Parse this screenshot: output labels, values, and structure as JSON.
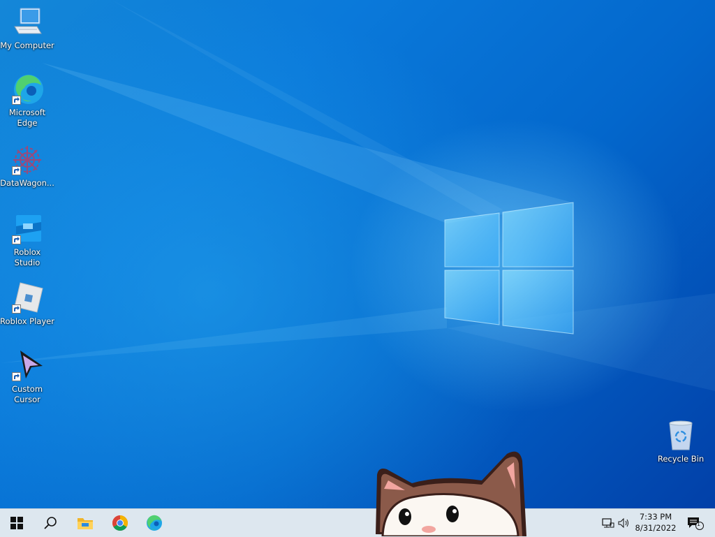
{
  "desktop": {
    "icons": [
      {
        "label": "My Computer",
        "icon": "computer-icon"
      },
      {
        "label": "Microsoft Edge",
        "label_lines": [
          "Microsoft",
          "Edge"
        ],
        "icon": "edge-icon",
        "shortcut": true
      },
      {
        "label": "DataWagon...",
        "icon": "datawagon-icon",
        "shortcut": true
      },
      {
        "label": "Roblox Studio",
        "icon": "roblox-studio-icon",
        "shortcut": true
      },
      {
        "label": "Roblox Player",
        "icon": "roblox-player-icon",
        "shortcut": true
      },
      {
        "label": "Custom Cursor",
        "label_lines": [
          "Custom",
          "Cursor"
        ],
        "icon": "cursor-icon",
        "shortcut": true
      }
    ],
    "recycle_bin": {
      "label": "Recycle Bin",
      "icon": "recycle-bin-icon"
    },
    "wallpaper": {
      "logo": "windows-logo",
      "accent": "#0a79da"
    }
  },
  "taskbar": {
    "pinned": [
      {
        "name": "start-button",
        "icon": "windows-logo-icon"
      },
      {
        "name": "search-button",
        "icon": "search-icon"
      },
      {
        "name": "file-explorer-button",
        "icon": "folder-icon"
      },
      {
        "name": "chrome-button",
        "icon": "chrome-icon"
      },
      {
        "name": "edge-button",
        "icon": "edge-icon"
      }
    ],
    "tray": {
      "network_icon": "network-icon",
      "volume_icon": "volume-icon",
      "time": "7:33 PM",
      "date": "8/31/2022",
      "notification_count": "1"
    }
  }
}
